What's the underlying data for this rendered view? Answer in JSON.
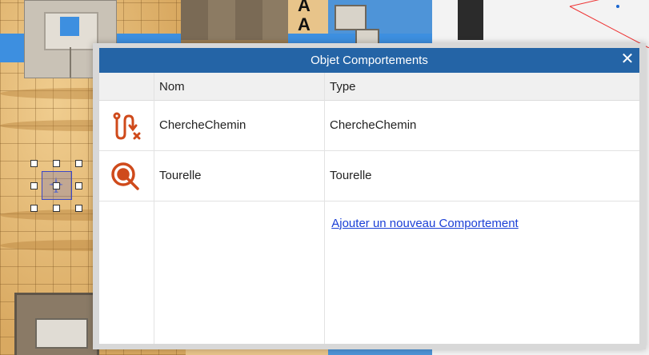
{
  "dialog": {
    "title": "Objet Comportements",
    "close_icon": "close-icon"
  },
  "table": {
    "headers": [
      "",
      "Nom",
      "Type"
    ],
    "rows": [
      {
        "icon": "pathfinding-icon",
        "name": "ChercheChemin",
        "type": "ChercheChemin"
      },
      {
        "icon": "turret-icon",
        "name": "Tourelle",
        "type": "Tourelle"
      }
    ],
    "add_label": "Ajouter un nouveau Comportement"
  },
  "scene": {
    "letters": [
      "A"
    ]
  },
  "colors": {
    "titlebar": "#2464a6",
    "icon_accent": "#cf4a1b",
    "link": "#1a3fd6"
  }
}
